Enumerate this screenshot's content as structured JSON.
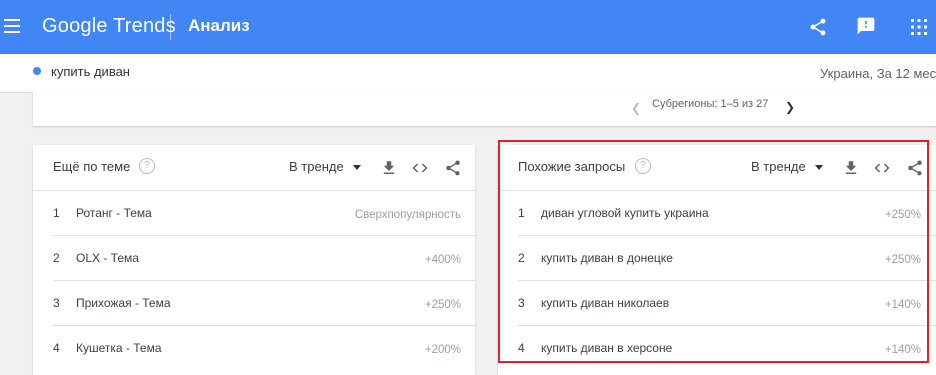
{
  "header": {
    "logo": "Google Trends",
    "page_title": "Анализ",
    "colors": {
      "bar": "#4285f4",
      "highlight": "#e0202a"
    },
    "icons": [
      "menu-icon",
      "share-icon",
      "feedback-icon",
      "apps-icon"
    ]
  },
  "search": {
    "term": "купить диван",
    "region_time": "Украина, За 12 мес"
  },
  "subregions": {
    "pager_text": "Субрегионы: 1–5 из 27"
  },
  "related_topics": {
    "title": "Ещё по теме",
    "filter": "В тренде",
    "rows": [
      {
        "rank": "1",
        "label": "Ротанг - Тема",
        "value": "Сверхпопулярность"
      },
      {
        "rank": "2",
        "label": "OLX - Тема",
        "value": "+400%"
      },
      {
        "rank": "3",
        "label": "Прихожая - Тема",
        "value": "+250%"
      },
      {
        "rank": "4",
        "label": "Кушетка - Тема",
        "value": "+200%"
      }
    ]
  },
  "related_queries": {
    "title": "Похожие запросы",
    "filter": "В тренде",
    "rows": [
      {
        "rank": "1",
        "label": "диван угловой купить украина",
        "value": "+250%"
      },
      {
        "rank": "2",
        "label": "купить диван в донецке",
        "value": "+250%"
      },
      {
        "rank": "3",
        "label": "купить диван николаев",
        "value": "+140%"
      },
      {
        "rank": "4",
        "label": "купить диван в херсоне",
        "value": "+140%"
      }
    ]
  }
}
